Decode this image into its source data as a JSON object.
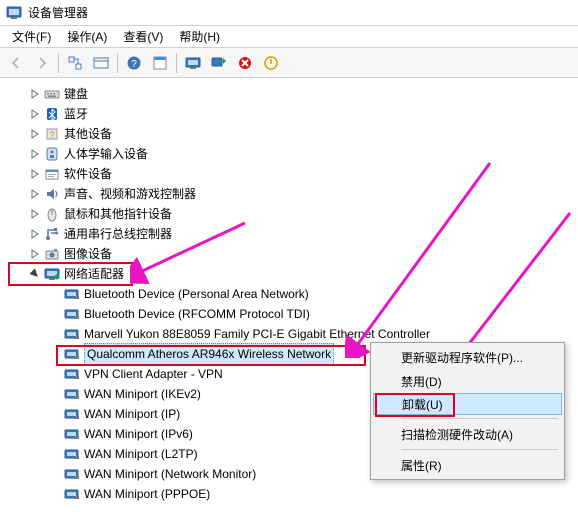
{
  "window": {
    "title": "设备管理器"
  },
  "menubar": {
    "file": "文件(F)",
    "action": "操作(A)",
    "view": "查看(V)",
    "help": "帮助(H)"
  },
  "toolbar_icons": {
    "back": "back-icon",
    "forward": "forward-icon",
    "up_tree": "up-tree-icon",
    "show_hidden": "show-hidden-icon",
    "properties": "properties-icon",
    "help": "help-icon",
    "computer": "computer-icon",
    "scan": "scan-hardware-icon",
    "uninstall": "uninstall-icon",
    "enable": "enable-icon"
  },
  "tree": {
    "categories": [
      {
        "label": "键盘"
      },
      {
        "label": "蓝牙"
      },
      {
        "label": "其他设备"
      },
      {
        "label": "人体学输入设备"
      },
      {
        "label": "软件设备"
      },
      {
        "label": "声音、视频和游戏控制器"
      },
      {
        "label": "鼠标和其他指针设备"
      },
      {
        "label": "通用串行总线控制器"
      },
      {
        "label": "图像设备"
      }
    ],
    "network": {
      "label": "网络适配器",
      "children": [
        {
          "label": "Bluetooth Device (Personal Area Network)"
        },
        {
          "label": "Bluetooth Device (RFCOMM Protocol TDI)"
        },
        {
          "label": "Marvell Yukon 88E8059 Family PCI-E Gigabit Ethernet Controller"
        },
        {
          "label": "Qualcomm Atheros AR946x Wireless Network",
          "selected": true
        },
        {
          "label": "VPN Client Adapter - VPN"
        },
        {
          "label": "WAN Miniport (IKEv2)"
        },
        {
          "label": "WAN Miniport (IP)"
        },
        {
          "label": "WAN Miniport (IPv6)"
        },
        {
          "label": "WAN Miniport (L2TP)"
        },
        {
          "label": "WAN Miniport (Network Monitor)"
        },
        {
          "label": "WAN Miniport (PPPOE)"
        }
      ]
    }
  },
  "context_menu": {
    "update_driver": "更新驱动程序软件(P)...",
    "disable": "禁用(D)",
    "uninstall": "卸载(U)",
    "scan_changes": "扫描检测硬件改动(A)",
    "properties": "属性(R)"
  }
}
